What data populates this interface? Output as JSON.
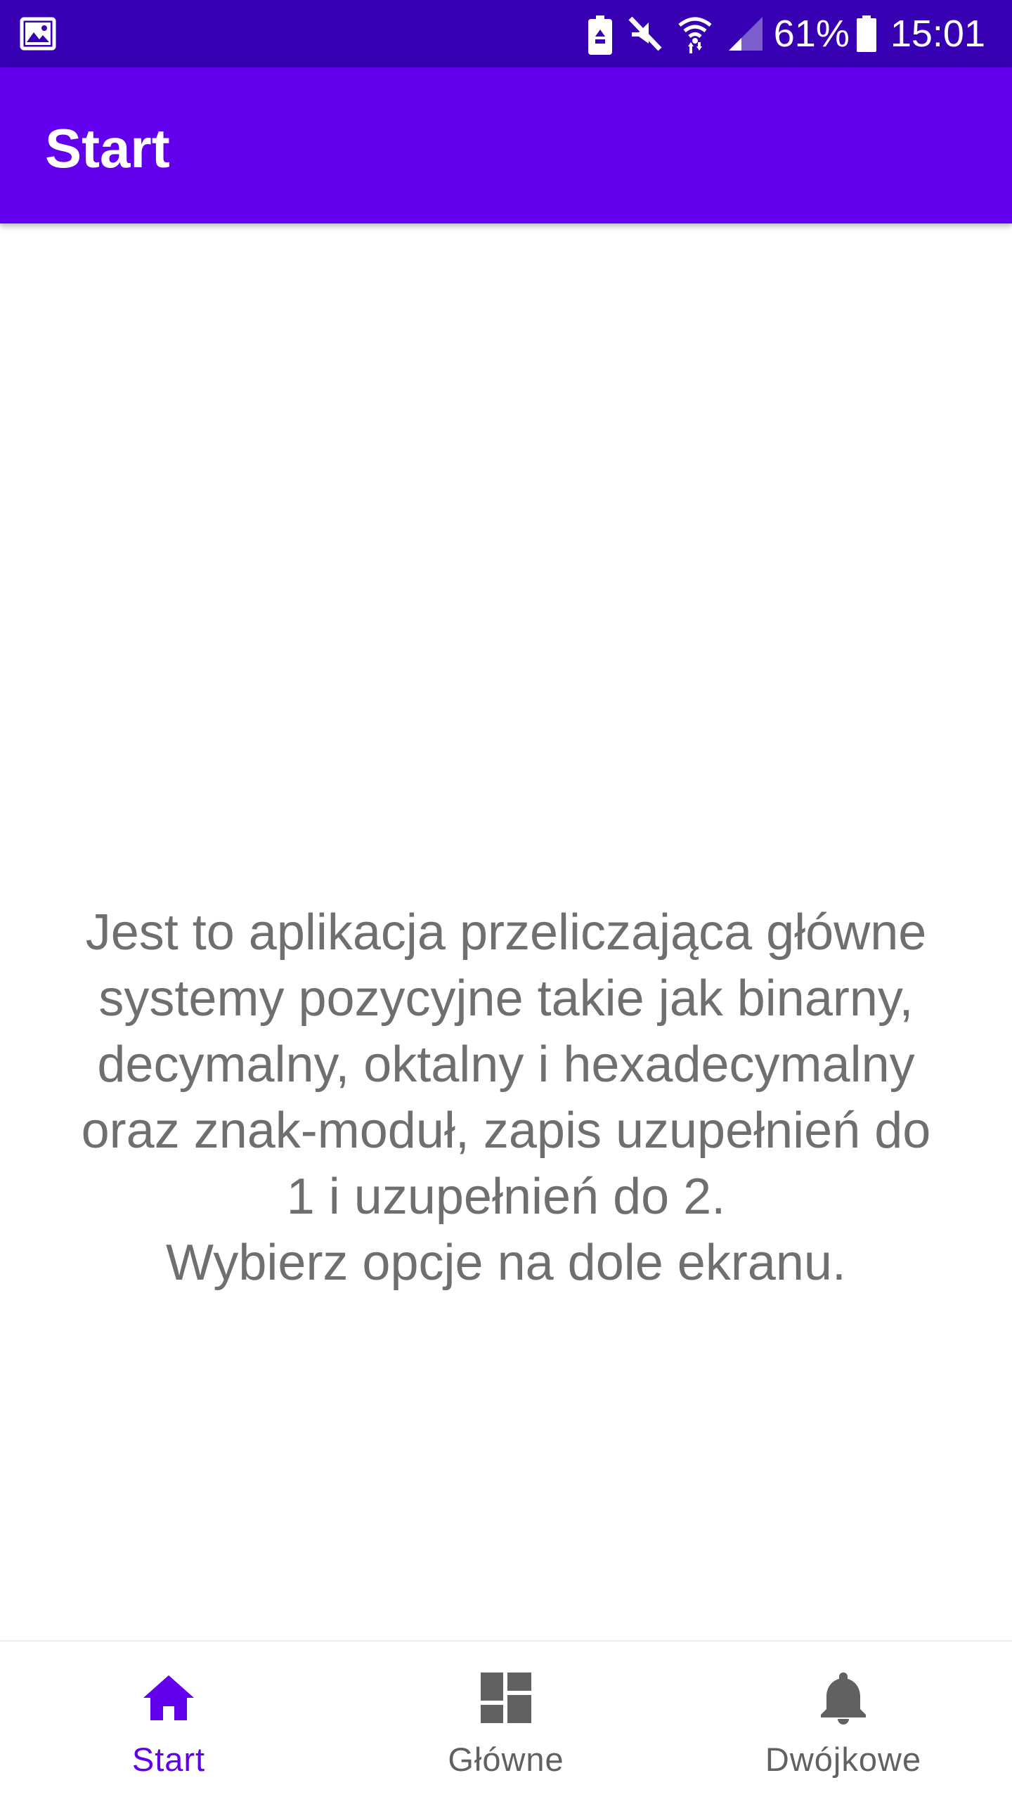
{
  "colors": {
    "status_bar": "#3700b3",
    "primary": "#6200ee",
    "text": "#6f6f6f",
    "nav_inactive": "#616161"
  },
  "status_bar": {
    "left_icon": "image-icon",
    "icons": [
      "battery-saver-icon",
      "mute-icon",
      "wifi-icon",
      "signal-icon"
    ],
    "battery_percent": "61%",
    "time": "15:01"
  },
  "app_bar": {
    "title": "Start"
  },
  "main": {
    "description": "Jest to aplikacja przeliczająca główne\nsystemy pozycyjne takie jak binarny,\ndecymalny, oktalny i hexadecymalny\noraz znak-moduł, zapis uzupełnień do\n1 i uzupełnień do 2.\nWybierz opcje na dole ekranu."
  },
  "bottom_nav": {
    "items": [
      {
        "label": "Start",
        "icon": "home-icon",
        "active": true
      },
      {
        "label": "Główne",
        "icon": "dashboard-icon",
        "active": false
      },
      {
        "label": "Dwójkowe",
        "icon": "bell-icon",
        "active": false
      }
    ]
  }
}
